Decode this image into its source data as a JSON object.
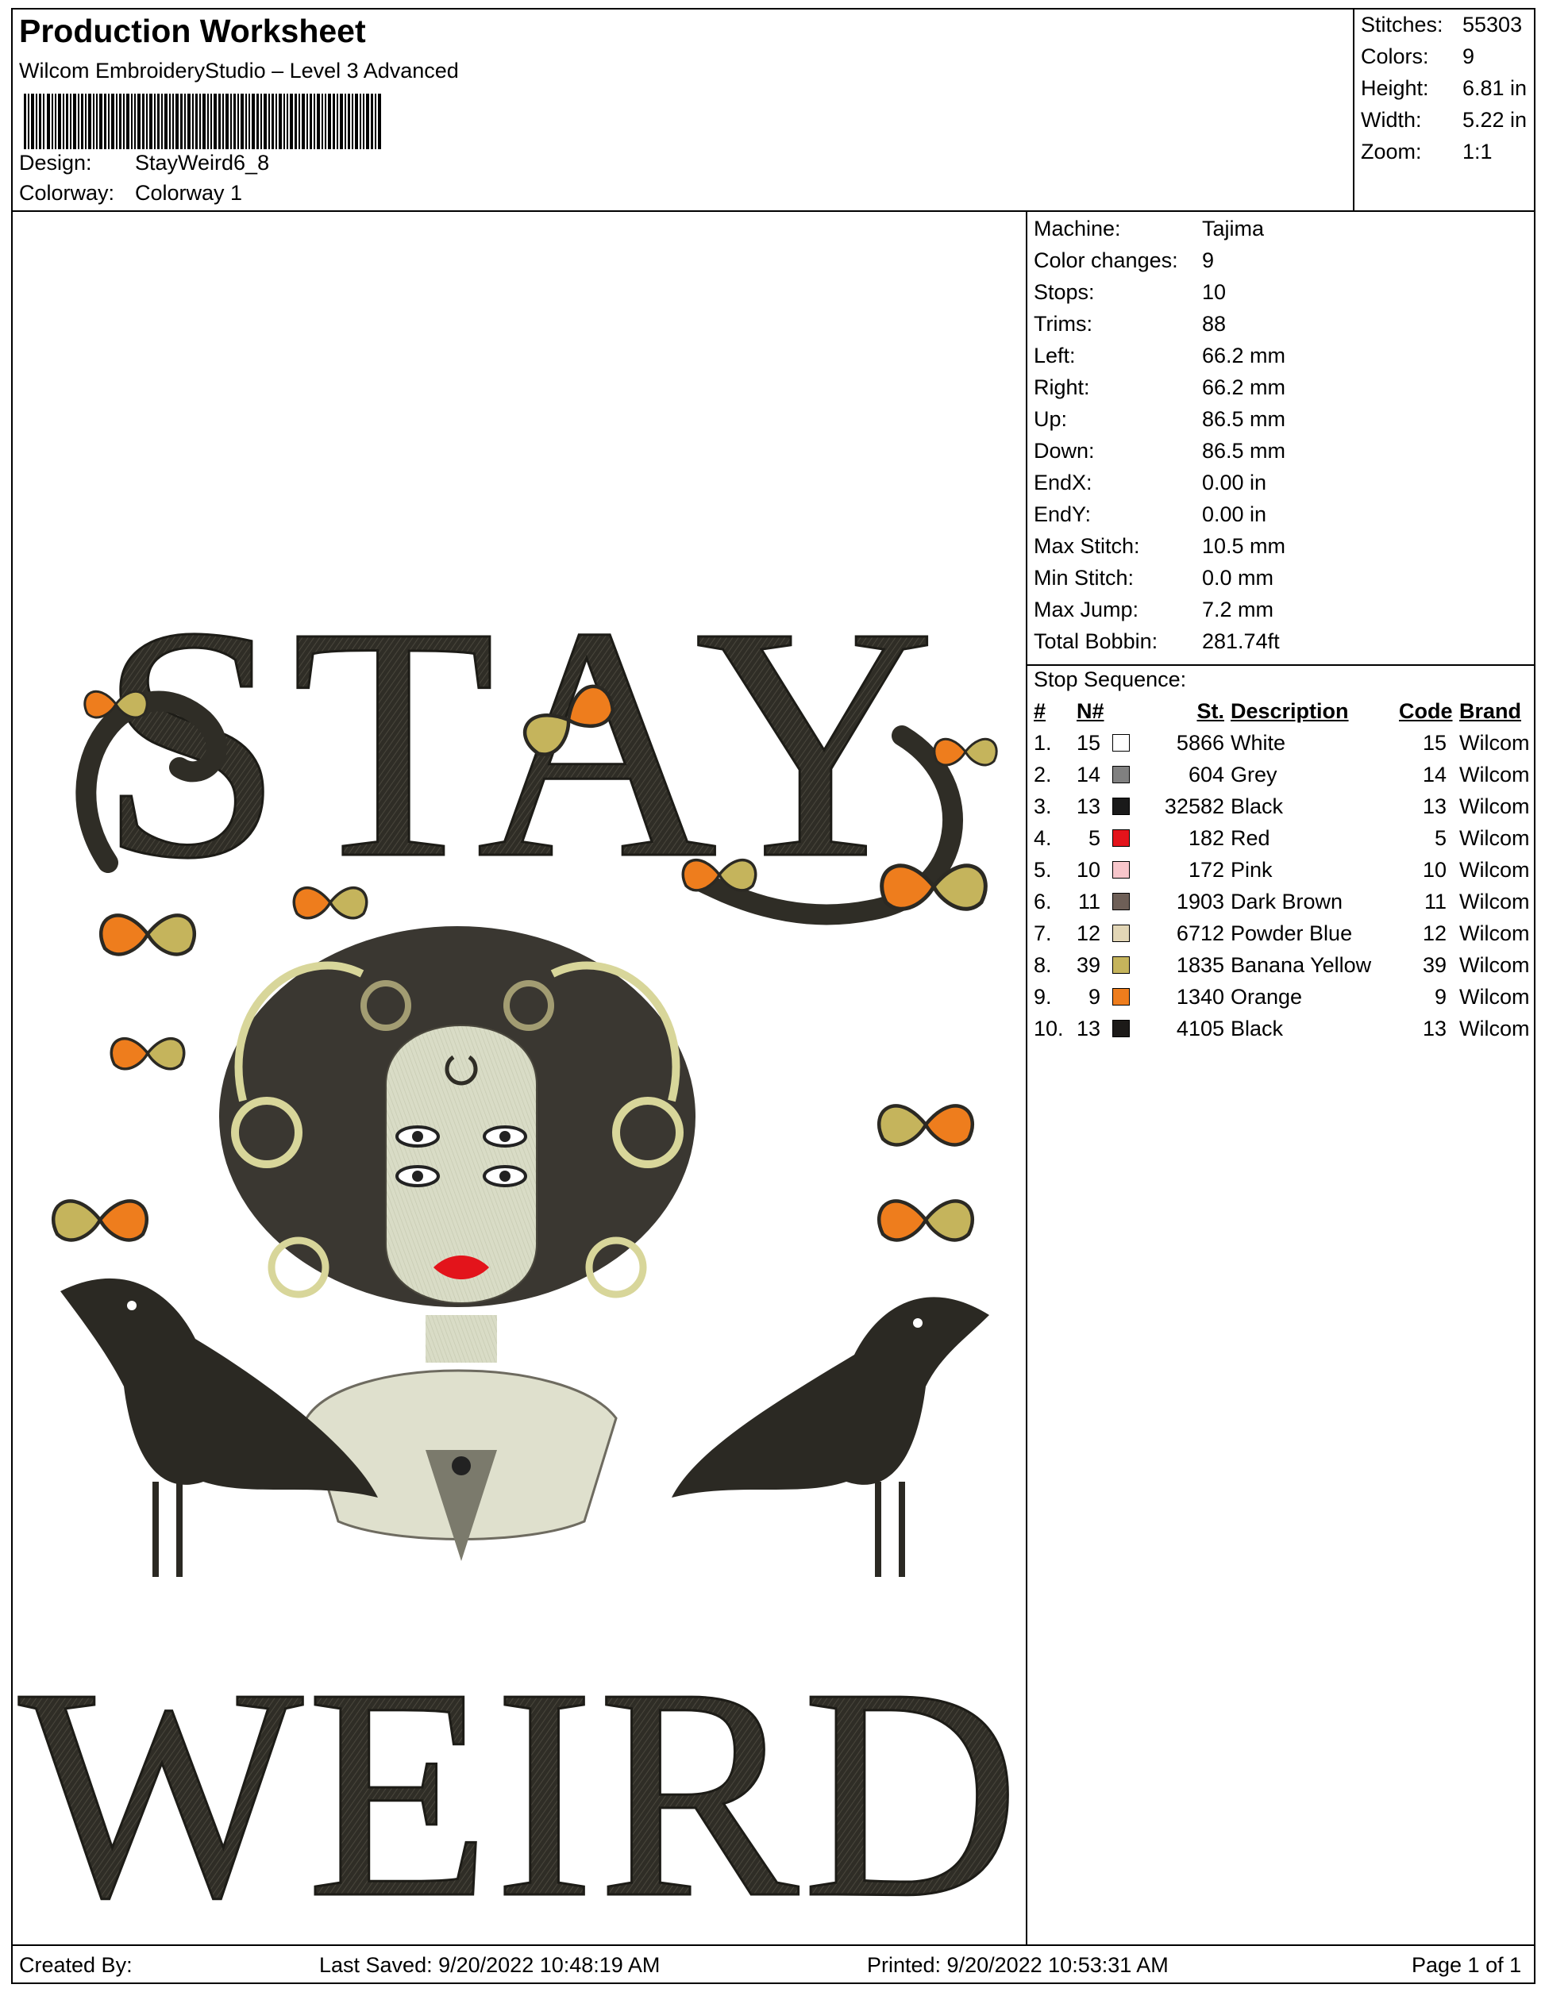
{
  "header": {
    "title": "Production Worksheet",
    "subtitle": "Wilcom EmbroideryStudio – Level 3 Advanced",
    "design_label": "Design:",
    "design_value": "StayWeird6_8",
    "colorway_label": "Colorway:",
    "colorway_value": "Colorway 1"
  },
  "summary": [
    {
      "label": "Stitches:",
      "value": "55303"
    },
    {
      "label": "Colors:",
      "value": "9"
    },
    {
      "label": "Height:",
      "value": "6.81 in"
    },
    {
      "label": "Width:",
      "value": "5.22 in"
    },
    {
      "label": "Zoom:",
      "value": "1:1"
    }
  ],
  "machine": [
    {
      "label": "Machine:",
      "value": "Tajima"
    },
    {
      "label": "Color changes:",
      "value": "9"
    },
    {
      "label": "Stops:",
      "value": "10"
    },
    {
      "label": "Trims:",
      "value": "88"
    },
    {
      "label": "Left:",
      "value": "66.2 mm"
    },
    {
      "label": "Right:",
      "value": "66.2 mm"
    },
    {
      "label": "Up:",
      "value": "86.5 mm"
    },
    {
      "label": "Down:",
      "value": "86.5 mm"
    },
    {
      "label": "EndX:",
      "value": "0.00 in"
    },
    {
      "label": "EndY:",
      "value": "0.00 in"
    },
    {
      "label": "Max Stitch:",
      "value": "10.5 mm"
    },
    {
      "label": "Min Stitch:",
      "value": "0.0 mm"
    },
    {
      "label": "Max Jump:",
      "value": "7.2 mm"
    },
    {
      "label": "Total Bobbin:",
      "value": "281.74ft"
    }
  ],
  "stop_sequence": {
    "title": "Stop Sequence:",
    "columns": [
      "#",
      "N#",
      "St.",
      "Description",
      "Code",
      "Brand"
    ],
    "rows": [
      {
        "idx": "1.",
        "n": "15",
        "color": "#ffffff",
        "st": "5866",
        "desc": "White",
        "code": "15",
        "brand": "Wilcom"
      },
      {
        "idx": "2.",
        "n": "14",
        "color": "#808080",
        "st": "604",
        "desc": "Grey",
        "code": "14",
        "brand": "Wilcom"
      },
      {
        "idx": "3.",
        "n": "13",
        "color": "#1a1a1a",
        "st": "32582",
        "desc": "Black",
        "code": "13",
        "brand": "Wilcom"
      },
      {
        "idx": "4.",
        "n": "5",
        "color": "#e3141b",
        "st": "182",
        "desc": "Red",
        "code": "5",
        "brand": "Wilcom"
      },
      {
        "idx": "5.",
        "n": "10",
        "color": "#f7c6cb",
        "st": "172",
        "desc": "Pink",
        "code": "10",
        "brand": "Wilcom"
      },
      {
        "idx": "6.",
        "n": "11",
        "color": "#6e5f57",
        "st": "1903",
        "desc": "Dark Brown",
        "code": "11",
        "brand": "Wilcom"
      },
      {
        "idx": "7.",
        "n": "12",
        "color": "#e2d6b6",
        "st": "6712",
        "desc": "Powder Blue",
        "code": "12",
        "brand": "Wilcom"
      },
      {
        "idx": "8.",
        "n": "39",
        "color": "#c5b45c",
        "st": "1835",
        "desc": "Banana Yellow",
        "code": "39",
        "brand": "Wilcom"
      },
      {
        "idx": "9.",
        "n": "9",
        "color": "#ee7d1d",
        "st": "1340",
        "desc": "Orange",
        "code": "9",
        "brand": "Wilcom"
      },
      {
        "idx": "10.",
        "n": "13",
        "color": "#1c1a18",
        "st": "4105",
        "desc": "Black",
        "code": "13",
        "brand": "Wilcom"
      }
    ]
  },
  "design_preview": {
    "word_top": "STAY",
    "word_bottom": "WEIRD"
  },
  "footer": {
    "created_by": "Created By:",
    "last_saved": "Last Saved: 9/20/2022 10:48:19 AM",
    "printed": "Printed: 9/20/2022 10:53:31 AM",
    "page": "Page 1 of 1"
  }
}
